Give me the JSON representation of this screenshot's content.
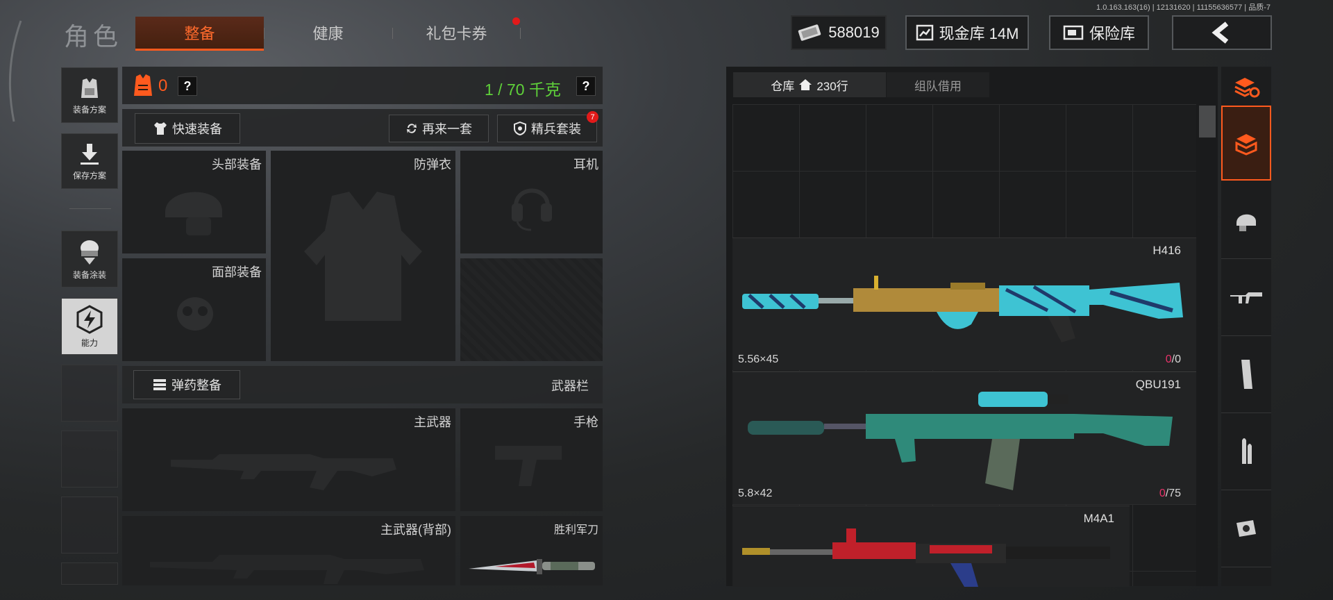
{
  "version": "1.0.163.163(16) | 12131620 | 11155636577 | 品质-7",
  "header": {
    "title": "角色",
    "tabs": [
      {
        "label": "整备",
        "active": true
      },
      {
        "label": "健康",
        "active": false
      },
      {
        "label": "礼包卡券",
        "active": false,
        "badge": true
      }
    ],
    "currency_value": "588019",
    "cash_vault_label": "现金库 14M",
    "safe_box_label": "保险库"
  },
  "sidebar": {
    "items": [
      {
        "label": "装备方案",
        "icon": "vest-plan-icon"
      },
      {
        "label": "保存方案",
        "icon": "download-save-icon"
      },
      {
        "label": "装备涂装",
        "icon": "paint-skin-icon"
      },
      {
        "label": "能力",
        "icon": "ability-bolt-icon"
      }
    ]
  },
  "loadout": {
    "armor_count": "0",
    "weight": "1 / 70 千克",
    "quick_equip": "快速装备",
    "retry": "再来一套",
    "elite_set": "精兵套装",
    "elite_badge": "7",
    "slots": {
      "helmet": "头部装备",
      "vest": "防弹衣",
      "headset": "耳机",
      "face": "面部装备"
    },
    "ammo_button": "弹药整备",
    "weapon_bar": "武器栏",
    "weapons": {
      "primary": "主武器",
      "pistol": "手枪",
      "primary_back": "主武器(背部)",
      "melee": "胜利军刀"
    }
  },
  "warehouse": {
    "tabs": [
      {
        "label": "仓库",
        "rows": "230行",
        "active": true
      },
      {
        "label": "组队借用",
        "active": false
      }
    ],
    "weapons": [
      {
        "name": "H416",
        "caliber": "5.56×45",
        "count_have": "0",
        "count_sep": "/",
        "count_total": "0"
      },
      {
        "name": "QBU191",
        "caliber": "5.8×42",
        "count_have": "0",
        "count_sep": "/",
        "count_total": "75"
      },
      {
        "name": "M4A1",
        "caliber": "",
        "count_have": "",
        "count_sep": "",
        "count_total": ""
      }
    ]
  },
  "categories": [
    "all-items-icon",
    "storage-box-icon",
    "helmet-category-icon",
    "rifle-category-icon",
    "magazine-category-icon",
    "ammo-category-icon",
    "scope-category-icon"
  ],
  "colors": {
    "accent": "#ff5a1e",
    "weight_green": "#5fd13a",
    "alert_red": "#e21a1a",
    "count_pink": "#e8336a"
  }
}
